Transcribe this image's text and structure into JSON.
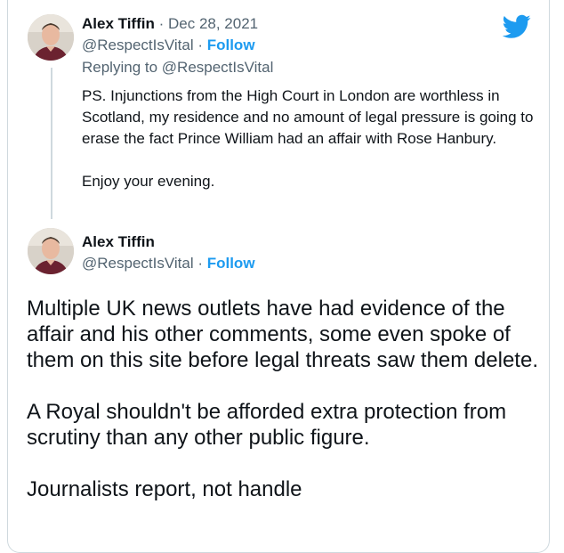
{
  "tweet1": {
    "author_name": "Alex Tiffin",
    "separator": " · ",
    "date": "Dec 28, 2021",
    "handle": "@RespectIsVital",
    "follow_sep": " · ",
    "follow_label": "Follow",
    "replying_prefix": "Replying to ",
    "replying_to": "@RespectIsVital",
    "text_p1": "PS. Injunctions from the High Court in London are worthless in Scotland, my residence and no amount of legal pressure is going to erase the fact Prince William had an affair with Rose Hanbury.",
    "text_p2": "Enjoy your evening."
  },
  "tweet2": {
    "author_name": "Alex Tiffin",
    "handle": "@RespectIsVital",
    "follow_sep": " · ",
    "follow_label": "Follow",
    "text_p1": "Multiple UK news outlets have had evidence of the affair and his other comments, some even spoke of them on this site before legal threats saw them delete.",
    "text_p2": "A Royal shouldn't be afforded extra protection from scrutiny than any other public figure.",
    "text_p3": "Journalists report, not handle"
  },
  "icons": {
    "logo": "twitter-bird-icon",
    "avatar": "avatar"
  },
  "colors": {
    "accent": "#1d9bf0",
    "muted": "#536471",
    "text": "#0f1419",
    "border": "#cfd9de"
  }
}
